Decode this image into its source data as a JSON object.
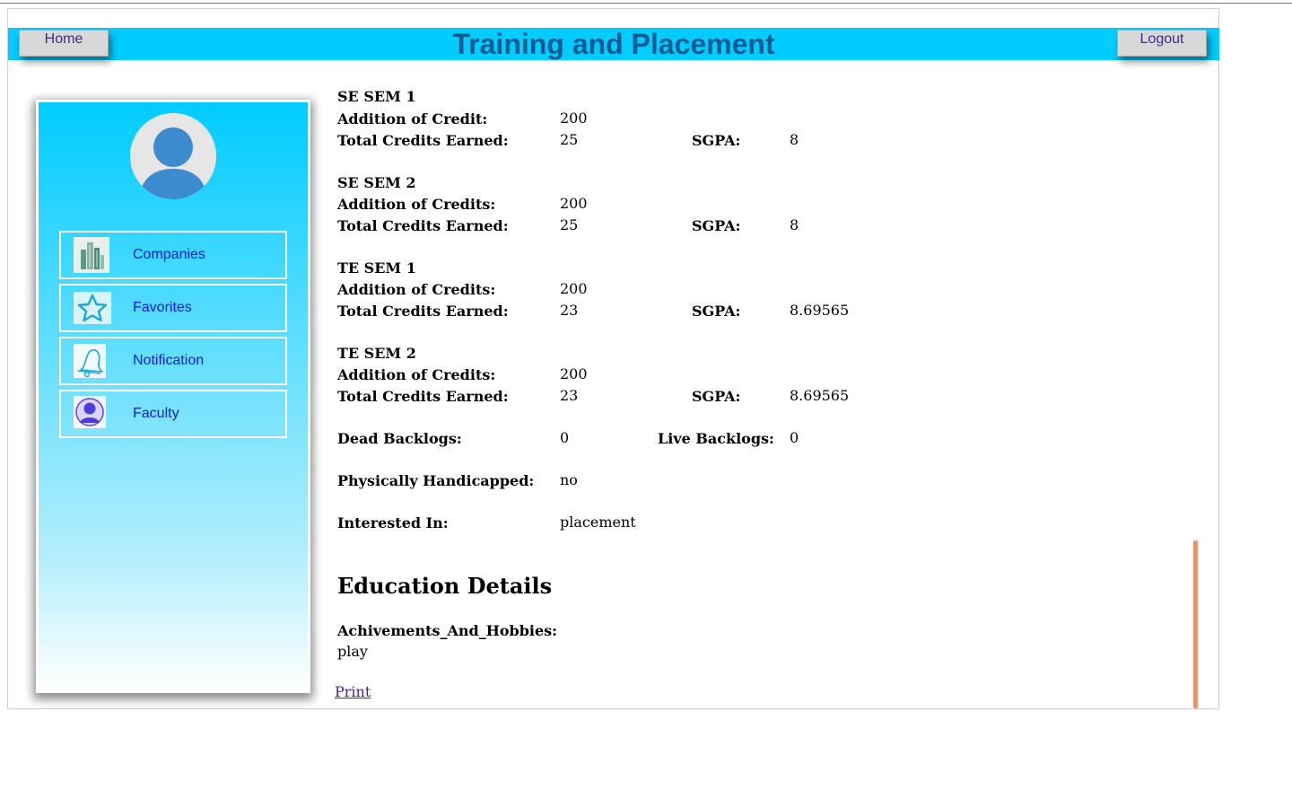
{
  "header": {
    "title": "Training and Placement",
    "home_label": "Home",
    "logout_label": "Logout",
    "background_color": "#00ccff",
    "title_color": "#0a5b91"
  },
  "sidebar": {
    "avatar_icon": "user-avatar-icon",
    "items": [
      {
        "label": "Companies",
        "icon": "buildings-icon"
      },
      {
        "label": "Favorites",
        "icon": "star-icon"
      },
      {
        "label": "Notification",
        "icon": "bell-icon"
      },
      {
        "label": "Faculty",
        "icon": "faculty-user-icon"
      }
    ]
  },
  "semesters": [
    {
      "title": "SE SEM 1",
      "credit_label": "Addition of Credit:",
      "credit_value": "200",
      "earned_label": "Total Credits Earned:",
      "earned_value": "25",
      "sgpa_label": "SGPA:",
      "sgpa_value": "8"
    },
    {
      "title": "SE SEM 2",
      "credit_label": "Addition of Credits:",
      "credit_value": "200",
      "earned_label": "Total Credits Earned:",
      "earned_value": "25",
      "sgpa_label": "SGPA:",
      "sgpa_value": "8"
    },
    {
      "title": "TE SEM 1",
      "credit_label": "Addition of Credits:",
      "credit_value": "200",
      "earned_label": "Total Credits Earned:",
      "earned_value": "23",
      "sgpa_label": "SGPA:",
      "sgpa_value": "8.69565"
    },
    {
      "title": "TE SEM 2",
      "credit_label": "Addition of Credits:",
      "credit_value": "200",
      "earned_label": "Total Credits Earned:",
      "earned_value": "23",
      "sgpa_label": "SGPA:",
      "sgpa_value": "8.69565"
    }
  ],
  "backlogs": {
    "dead_label": "Dead Backlogs:",
    "dead_value": "0",
    "live_label": "Live Backlogs:",
    "live_value": "0"
  },
  "handicapped": {
    "label": "Physically Handicapped:",
    "value": "no"
  },
  "interested": {
    "label": "Interested In:",
    "value": "placement"
  },
  "education": {
    "heading": "Education Details",
    "hobbies_label": "Achivements_And_Hobbies:",
    "hobbies_value": "play"
  },
  "print_label": "Print"
}
